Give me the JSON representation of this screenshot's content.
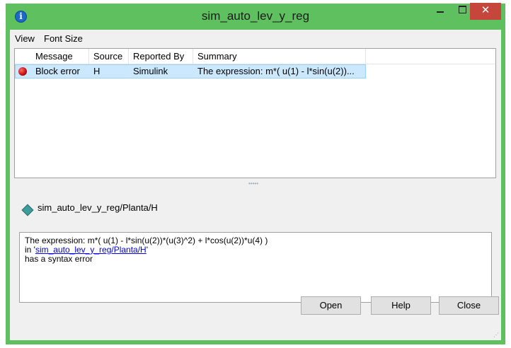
{
  "window": {
    "title": "sim_auto_lev_y_reg",
    "minimize": "",
    "close": "✕"
  },
  "menu": {
    "items": [
      "View",
      "Font Size"
    ]
  },
  "table": {
    "columns": [
      "Message",
      "Source",
      "Reported By",
      "Summary"
    ],
    "rows": [
      {
        "message": "Block error",
        "source": "H",
        "reported_by": "Simulink",
        "summary": "The expression: m*(  u(1) - l*sin(u(2))..."
      }
    ]
  },
  "details": {
    "path": "sim_auto_lev_y_reg/Planta/H",
    "line1": "The expression: m*( u(1) - l*sin(u(2))*(u(3)^2) + l*cos(u(2))*u(4) )",
    "line2_prefix": "in '",
    "link": "sim_auto_lev_y_reg/Planta/H",
    "line2_suffix": "'",
    "line3": "has a syntax error"
  },
  "buttons": {
    "open": "Open",
    "help": "Help",
    "close": "Close"
  },
  "colors": {
    "titlebar": "#5ec05e",
    "close_button": "#c7463b",
    "selection": "#cce8ff",
    "link": "#0000ee"
  }
}
